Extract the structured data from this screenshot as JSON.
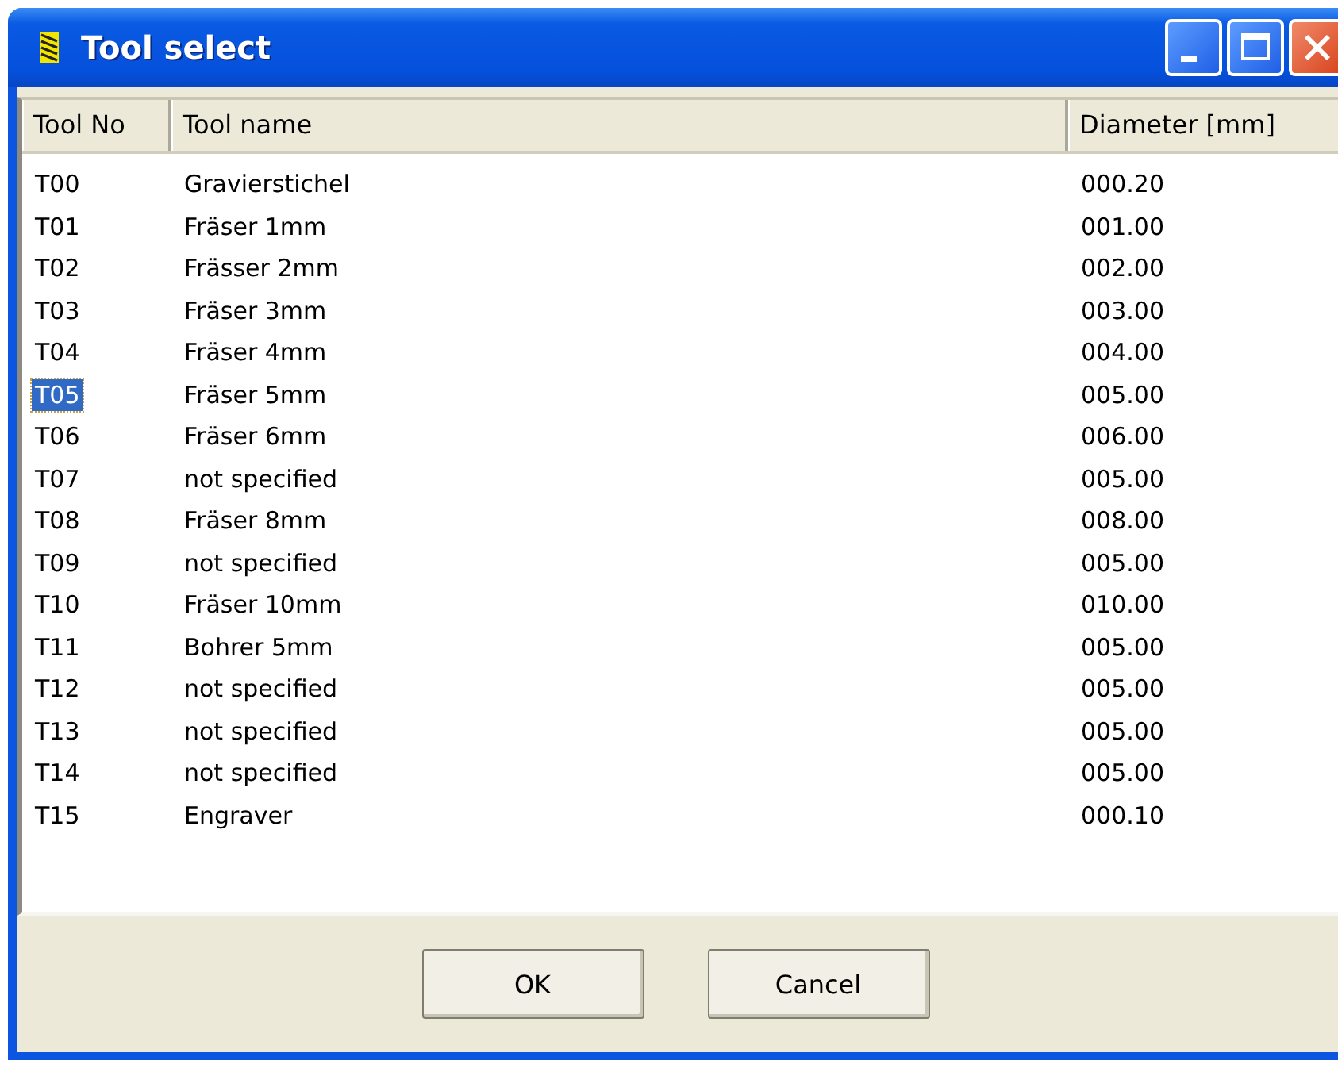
{
  "window": {
    "title": "Tool select"
  },
  "table": {
    "columns": [
      "Tool No",
      "Tool name",
      "Diameter [mm]"
    ],
    "rows": [
      {
        "cells": [
          "T00",
          "Gravierstichel",
          "000.20"
        ],
        "selected": false
      },
      {
        "cells": [
          "T01",
          "Fräser 1mm",
          "001.00"
        ],
        "selected": false
      },
      {
        "cells": [
          "T02",
          "Frässer 2mm",
          "002.00"
        ],
        "selected": false
      },
      {
        "cells": [
          "T03",
          "Fräser 3mm",
          "003.00"
        ],
        "selected": false
      },
      {
        "cells": [
          "T04",
          "Fräser 4mm",
          "004.00"
        ],
        "selected": false
      },
      {
        "cells": [
          "T05",
          "Fräser 5mm",
          "005.00"
        ],
        "selected": true
      },
      {
        "cells": [
          "T06",
          "Fräser 6mm",
          "006.00"
        ],
        "selected": false
      },
      {
        "cells": [
          "T07",
          "not specified",
          "005.00"
        ],
        "selected": false
      },
      {
        "cells": [
          "T08",
          "Fräser 8mm",
          "008.00"
        ],
        "selected": false
      },
      {
        "cells": [
          "T09",
          "not specified",
          "005.00"
        ],
        "selected": false
      },
      {
        "cells": [
          "T10",
          "Fräser 10mm",
          "010.00"
        ],
        "selected": false
      },
      {
        "cells": [
          "T11",
          "Bohrer 5mm",
          "005.00"
        ],
        "selected": false
      },
      {
        "cells": [
          "T12",
          "not specified",
          "005.00"
        ],
        "selected": false
      },
      {
        "cells": [
          "T13",
          "not specified",
          "005.00"
        ],
        "selected": false
      },
      {
        "cells": [
          "T14",
          "not specified",
          "005.00"
        ],
        "selected": false
      },
      {
        "cells": [
          "T15",
          "Engraver",
          "000.10"
        ],
        "selected": false
      }
    ]
  },
  "buttons": [
    "OK",
    "Cancel"
  ]
}
